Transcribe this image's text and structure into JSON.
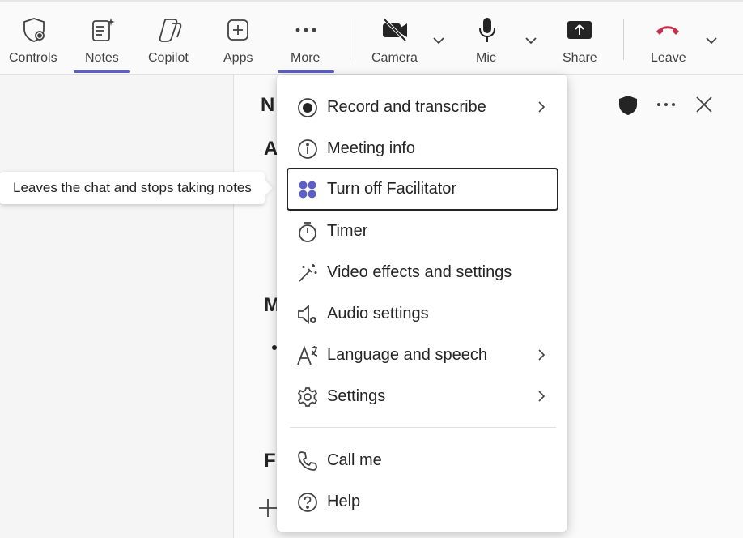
{
  "toolbar": {
    "items": [
      {
        "label": "Controls",
        "icon": "shield-gear-icon"
      },
      {
        "label": "Notes",
        "icon": "notes-sparkle-icon",
        "active": true
      },
      {
        "label": "Copilot",
        "icon": "copilot-icon"
      },
      {
        "label": "Apps",
        "icon": "plus-square-icon"
      },
      {
        "label": "More",
        "icon": "more-dots-icon",
        "active": true
      },
      {
        "label": "Camera",
        "icon": "camera-off-icon"
      },
      {
        "label": "Mic",
        "icon": "mic-icon"
      },
      {
        "label": "Share",
        "icon": "share-tray-icon"
      },
      {
        "label": "Leave",
        "icon": "hangup-icon"
      }
    ],
    "accent_color": "#5b5fc7",
    "leave_color": "#c4314b"
  },
  "notes_pane": {
    "title_peek": "N",
    "peek_letters": [
      "A",
      "M",
      "F"
    ]
  },
  "tooltip": {
    "text": "Leaves the chat and stops taking notes"
  },
  "menu": {
    "items": [
      {
        "label": "Record and transcribe",
        "icon": "record-icon",
        "submenu": true
      },
      {
        "label": "Meeting info",
        "icon": "info-icon",
        "submenu": false
      },
      {
        "label": "Turn off Facilitator",
        "icon": "facilitator-icon",
        "submenu": false,
        "focused": true
      },
      {
        "label": "Timer",
        "icon": "timer-icon",
        "submenu": false
      },
      {
        "label": "Video effects and settings",
        "icon": "magic-wand-icon",
        "submenu": false
      },
      {
        "label": "Audio settings",
        "icon": "speaker-gear-icon",
        "submenu": false
      },
      {
        "label": "Language and speech",
        "icon": "language-icon",
        "submenu": true
      },
      {
        "label": "Settings",
        "icon": "gear-icon",
        "submenu": true
      }
    ],
    "secondary_items": [
      {
        "label": "Call me",
        "icon": "phone-icon"
      },
      {
        "label": "Help",
        "icon": "help-icon"
      }
    ],
    "facilitator_color": "#5b5fc7"
  }
}
